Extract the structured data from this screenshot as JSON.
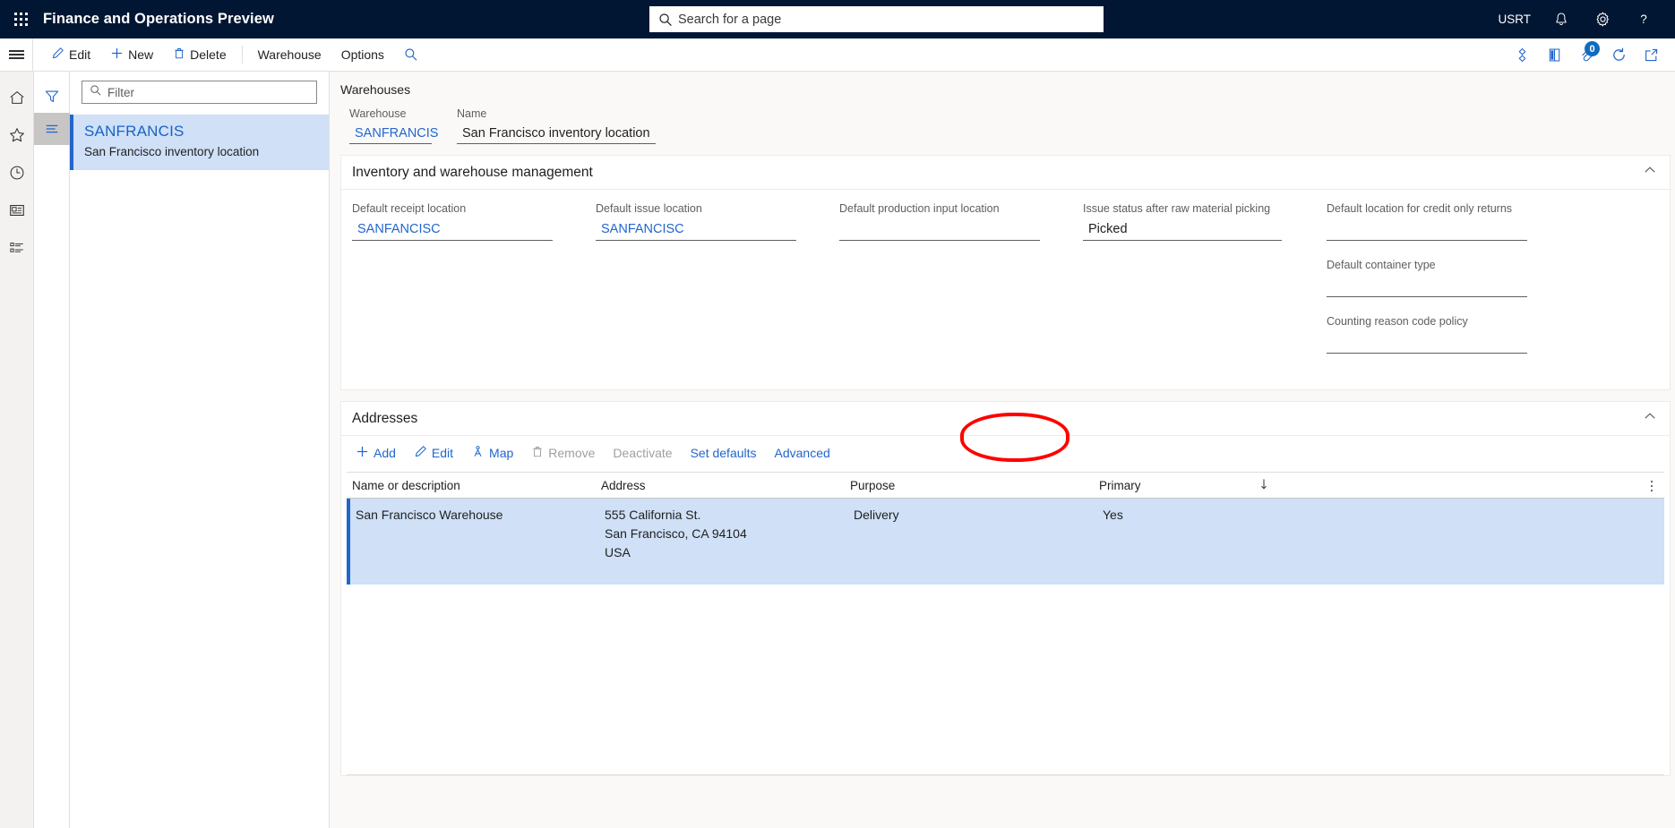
{
  "topnav": {
    "app_title": "Finance and Operations Preview",
    "waffle_icon": "app-launcher-icon",
    "search": {
      "placeholder": "Search for a page",
      "value": "",
      "icon": "search-icon"
    },
    "company": "USRT",
    "notifications_icon": "bell-icon",
    "settings_icon": "gear-icon",
    "help_icon": "question-mark-icon",
    "bg_color": "#001633"
  },
  "commandbar": {
    "hamburger_icon": "hamburger-menu-icon",
    "buttons": [
      {
        "label": "Edit",
        "icon": "pencil-icon"
      },
      {
        "label": "New",
        "icon": "plus-icon"
      },
      {
        "label": "Delete",
        "icon": "trash-icon"
      },
      {
        "label": "Warehouse",
        "icon": ""
      },
      {
        "label": "Options",
        "icon": ""
      }
    ],
    "search_icon": "search-icon",
    "right_icons": [
      {
        "name": "share-icon",
        "badge": ""
      },
      {
        "name": "office-app-icon",
        "badge": ""
      },
      {
        "name": "attachment-icon",
        "badge": "0"
      },
      {
        "name": "refresh-icon",
        "badge": ""
      },
      {
        "name": "open-in-new-window-icon",
        "badge": ""
      }
    ],
    "attachment_badge": "0",
    "accent_color": "#0f6cbd"
  },
  "rail": {
    "items": [
      {
        "name": "home-icon",
        "label": "Home"
      },
      {
        "name": "favorites-star-icon",
        "label": "Favorites"
      },
      {
        "name": "recent-clock-icon",
        "label": "Recent"
      },
      {
        "name": "workspaces-icon",
        "label": "Workspaces"
      },
      {
        "name": "modules-list-icon",
        "label": "Modules"
      }
    ]
  },
  "filterstrip": {
    "filter_icon": "funnel-filter-icon",
    "list_icon": "list-lines-icon"
  },
  "listpane": {
    "filter": {
      "placeholder": "Filter",
      "value": "",
      "icon": "search-icon"
    },
    "items": [
      {
        "title": "SANFRANCIS",
        "subtitle": "San Francisco inventory location",
        "selected": true
      }
    ]
  },
  "page": {
    "breadcrumb": "Warehouses",
    "header_fields": [
      {
        "label": "Warehouse",
        "value": "SANFRANCIS",
        "is_link": true
      },
      {
        "label": "Name",
        "value": "San Francisco inventory location",
        "is_link": false
      }
    ]
  },
  "inventory_section": {
    "title": "Inventory and warehouse management",
    "collapse_icon": "chevron-up-icon",
    "columns": [
      {
        "fields": [
          {
            "label": "Default receipt location",
            "value": "SANFANCISC",
            "is_link": true
          }
        ]
      },
      {
        "fields": [
          {
            "label": "Default issue location",
            "value": "SANFANCISC",
            "is_link": true
          }
        ]
      },
      {
        "fields": [
          {
            "label": "Default production input location",
            "value": "",
            "is_link": false
          }
        ]
      },
      {
        "fields": [
          {
            "label": "Issue status after raw material picking",
            "value": "Picked",
            "is_link": false
          }
        ]
      },
      {
        "fields": [
          {
            "label": "Default location for credit only returns",
            "value": "",
            "is_link": false
          },
          {
            "label": "Default container type",
            "value": "",
            "is_link": false
          },
          {
            "label": "Counting reason code policy",
            "value": "",
            "is_link": false
          }
        ]
      }
    ]
  },
  "addresses_section": {
    "title": "Addresses",
    "collapse_icon": "chevron-up-icon",
    "toolbar": [
      {
        "label": "Add",
        "icon": "plus-icon",
        "disabled": false
      },
      {
        "label": "Edit",
        "icon": "pencil-icon",
        "disabled": false
      },
      {
        "label": "Map",
        "icon": "map-person-icon",
        "disabled": false
      },
      {
        "label": "Remove",
        "icon": "trash-icon",
        "disabled": true
      },
      {
        "label": "Deactivate",
        "icon": "",
        "disabled": true
      },
      {
        "label": "Set defaults",
        "icon": "",
        "disabled": false
      },
      {
        "label": "Advanced",
        "icon": "",
        "disabled": false,
        "highlighted": true
      }
    ],
    "table": {
      "columns": [
        "Name or description",
        "Address",
        "Purpose",
        "Primary"
      ],
      "sort_column": "Primary",
      "sort_icon": "arrow-down-icon",
      "overflow_icon": "more-vertical-icon",
      "rows": [
        {
          "name": "San Francisco Warehouse",
          "address_lines": [
            "555 California St.",
            "San Francisco, CA 94104",
            "USA"
          ],
          "purpose": "Delivery",
          "primary": "Yes",
          "selected": true
        }
      ]
    }
  },
  "annotation": {
    "shape": "red-ellipse",
    "color": "#ff0000",
    "target_label": "Advanced"
  }
}
